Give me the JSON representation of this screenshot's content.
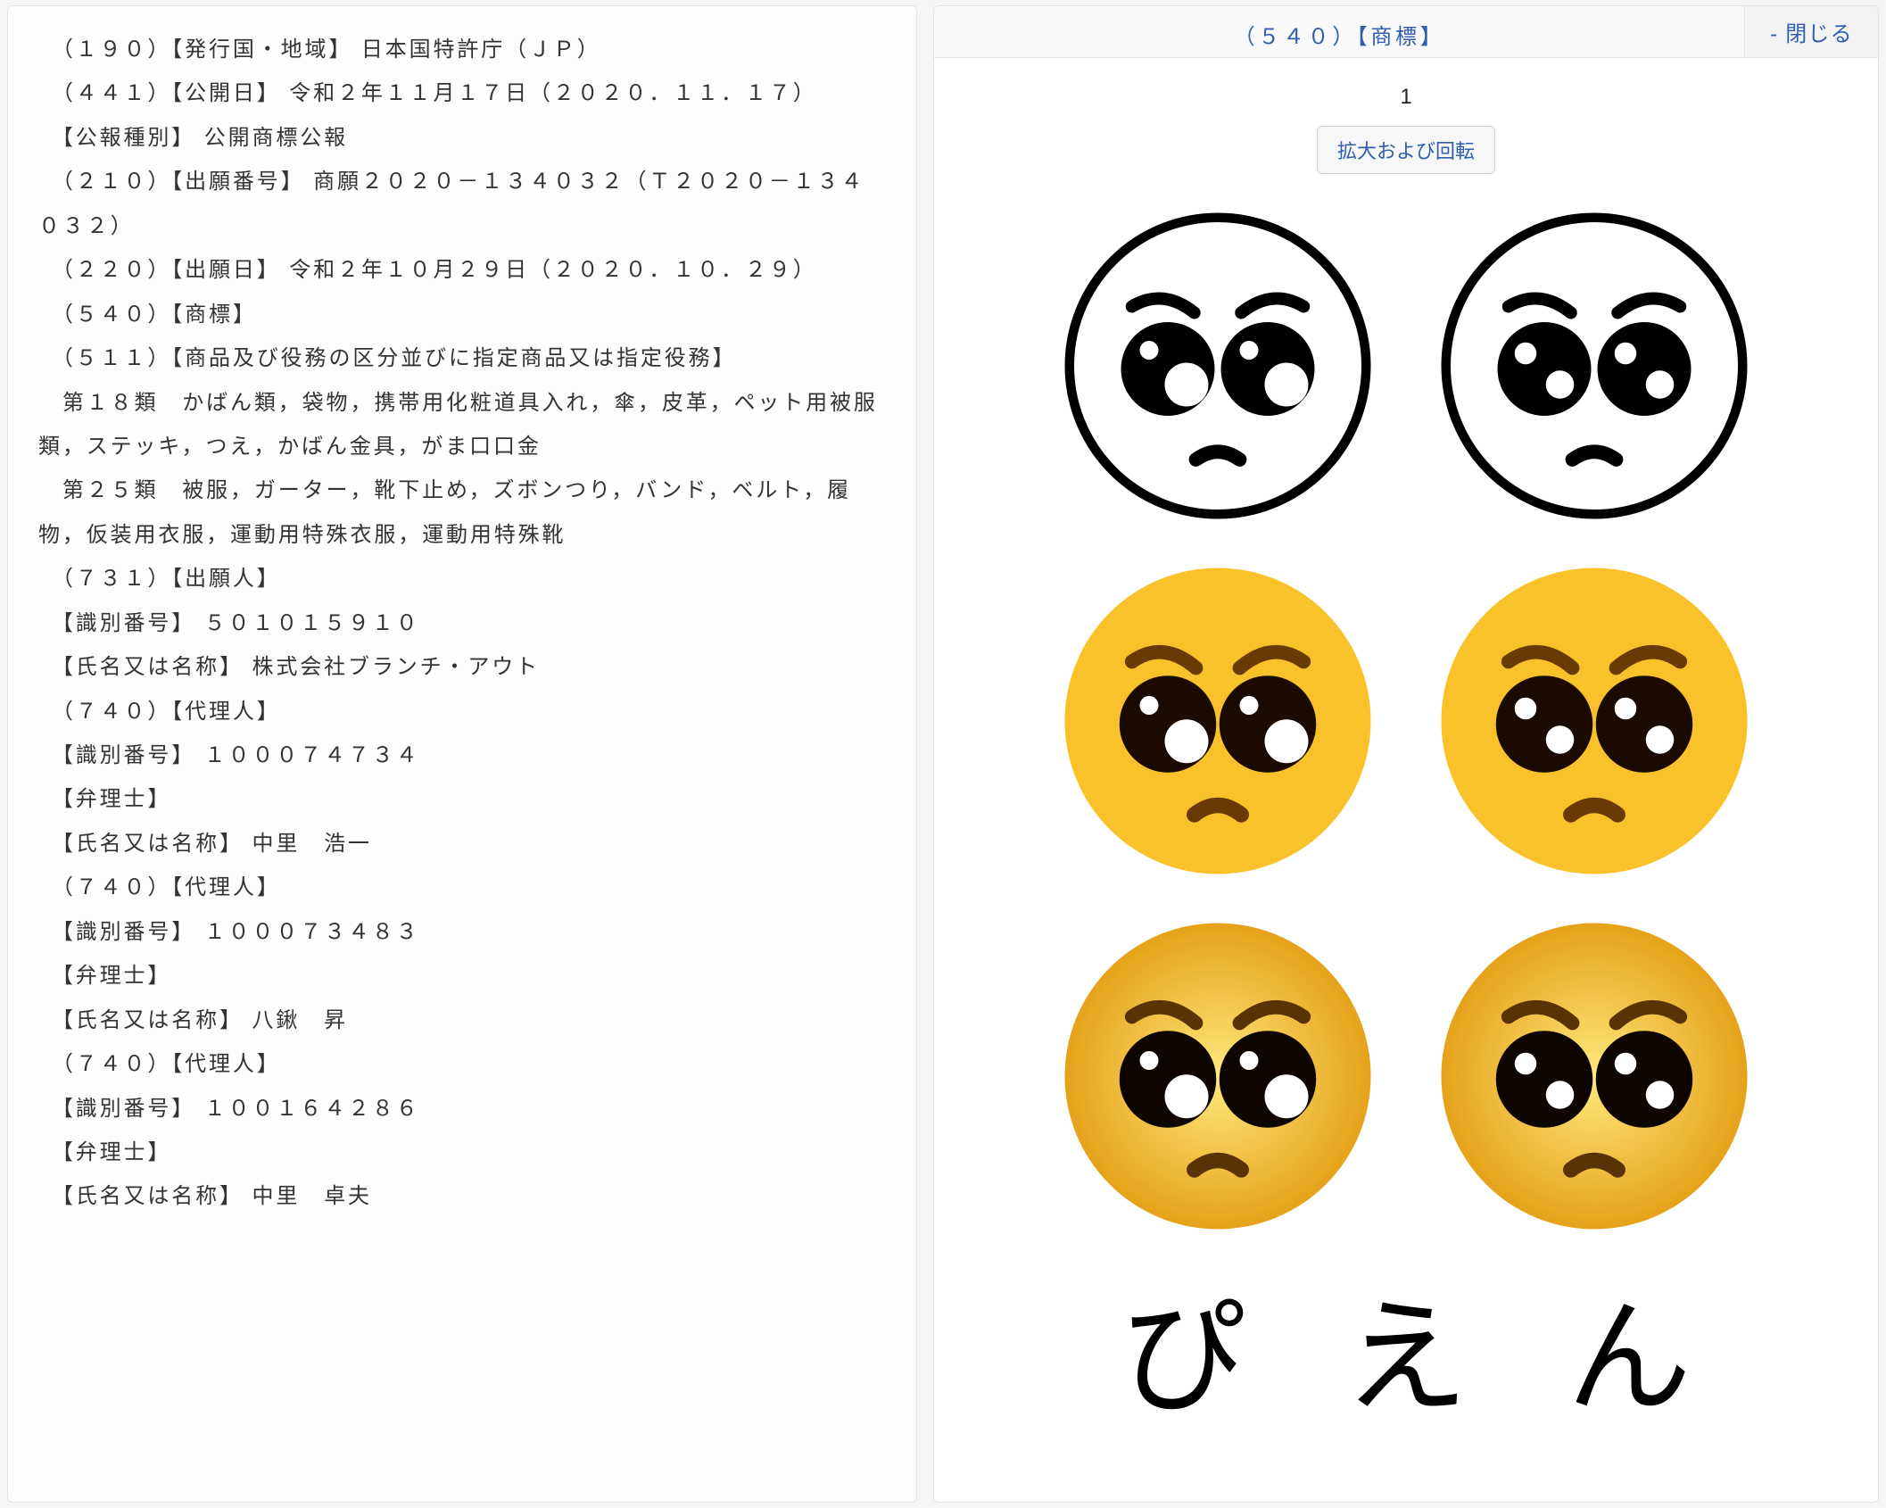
{
  "left_text": "　（１９０）【発行国・地域】 日本国特許庁（ＪＰ）\n　（４４１）【公開日】 令和２年１１月１７日（２０２０．１１．１７）\n　【公報種別】 公開商標公報\n　（２１０）【出願番号】 商願２０２０－１３４０３２（Ｔ２０２０－１３４０３２）\n　（２２０）【出願日】 令和２年１０月２９日（２０２０．１０．２９）\n　（５４０）【商標】\n　（５１１）【商品及び役務の区分並びに指定商品又は指定役務】\n　第１８類　かばん類，袋物，携帯用化粧道具入れ，傘，皮革，ペット用被服類，ステッキ，つえ，かばん金具，がま口口金\n　第２５類　被服，ガーター，靴下止め，ズボンつり，バンド，ベルト，履物，仮装用衣服，運動用特殊衣服，運動用特殊靴\n　（７３１）【出願人】\n　【識別番号】 ５０１０１５９１０\n　【氏名又は名称】 株式会社ブランチ・アウト\n　（７４０）【代理人】\n　【識別番号】 １０００７４７３４\n　【弁理士】\n　【氏名又は名称】 中里　浩一\n　（７４０）【代理人】\n　【識別番号】 １０００７３４８３\n　【弁理士】\n　【氏名又は名称】 八鍬　昇\n　（７４０）【代理人】\n　【識別番号】 １００１６４２８６\n　【弁理士】\n　【氏名又は名称】 中里　卓夫",
  "right": {
    "title": "（５４０）【商標】",
    "close_label": "- 閉じる",
    "page_number": "1",
    "zoom_label": "拡大および回転",
    "kana": [
      "ぴ",
      "え",
      "ん"
    ]
  }
}
